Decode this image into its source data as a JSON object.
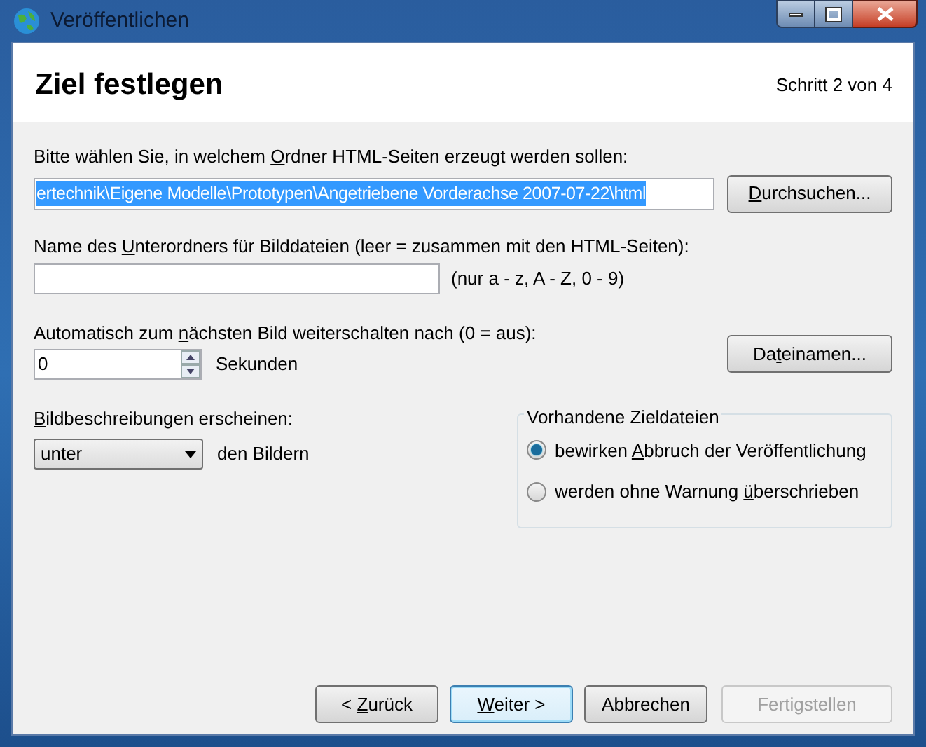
{
  "window": {
    "title": "Veröffentlichen"
  },
  "header": {
    "title": "Ziel festlegen",
    "step": "Schritt 2 von 4"
  },
  "folder": {
    "label": {
      "before": "Bitte wählen Sie, in welchem ",
      "key": "O",
      "after": "rdner HTML-Seiten erzeugt werden sollen:"
    },
    "value": "ertechnik\\Eigene Modelle\\Prototypen\\Angetriebene Vorderachse 2007-07-22\\html",
    "text_selected": true,
    "button": {
      "key": "D",
      "after": "urchsuchen..."
    }
  },
  "subfolder": {
    "label": {
      "before": "Name des ",
      "key": "U",
      "after": "nterordners für Bilddateien (leer = zusammen mit den HTML-Seiten):"
    },
    "hint": "(nur a - z, A - Z, 0 - 9)"
  },
  "autoadvance": {
    "label": {
      "before": "Automatisch zum ",
      "key": "n",
      "after": "ächsten Bild weiterschalten nach (0 = aus):"
    },
    "value": "0",
    "unit": "Sekunden",
    "button": {
      "before": "Da",
      "key": "t",
      "after": "einamen..."
    }
  },
  "captions": {
    "label": {
      "key": "B",
      "after": "ildbeschreibungen erscheinen:"
    },
    "value": "unter",
    "suffix": "den Bildern"
  },
  "existing": {
    "title": "Vorhandene Zieldateien",
    "options": [
      {
        "label": {
          "before": "bewirken ",
          "key": "A",
          "after": "bbruch der Veröffentlichung"
        },
        "selected": true
      },
      {
        "label": {
          "before": "werden ohne Warnung ",
          "key": "ü",
          "after": "berschrieben"
        },
        "selected": false
      }
    ]
  },
  "buttons": [
    {
      "label": {
        "before": "< ",
        "key": "Z",
        "after": "urück"
      },
      "default": false,
      "disabled": false
    },
    {
      "label": {
        "key": "W",
        "after": "eiter >"
      },
      "default": true,
      "disabled": false
    },
    {
      "label": "Abbrechen",
      "default": false,
      "disabled": false
    },
    {
      "label": "Fertigstellen",
      "default": false,
      "disabled": true
    }
  ]
}
